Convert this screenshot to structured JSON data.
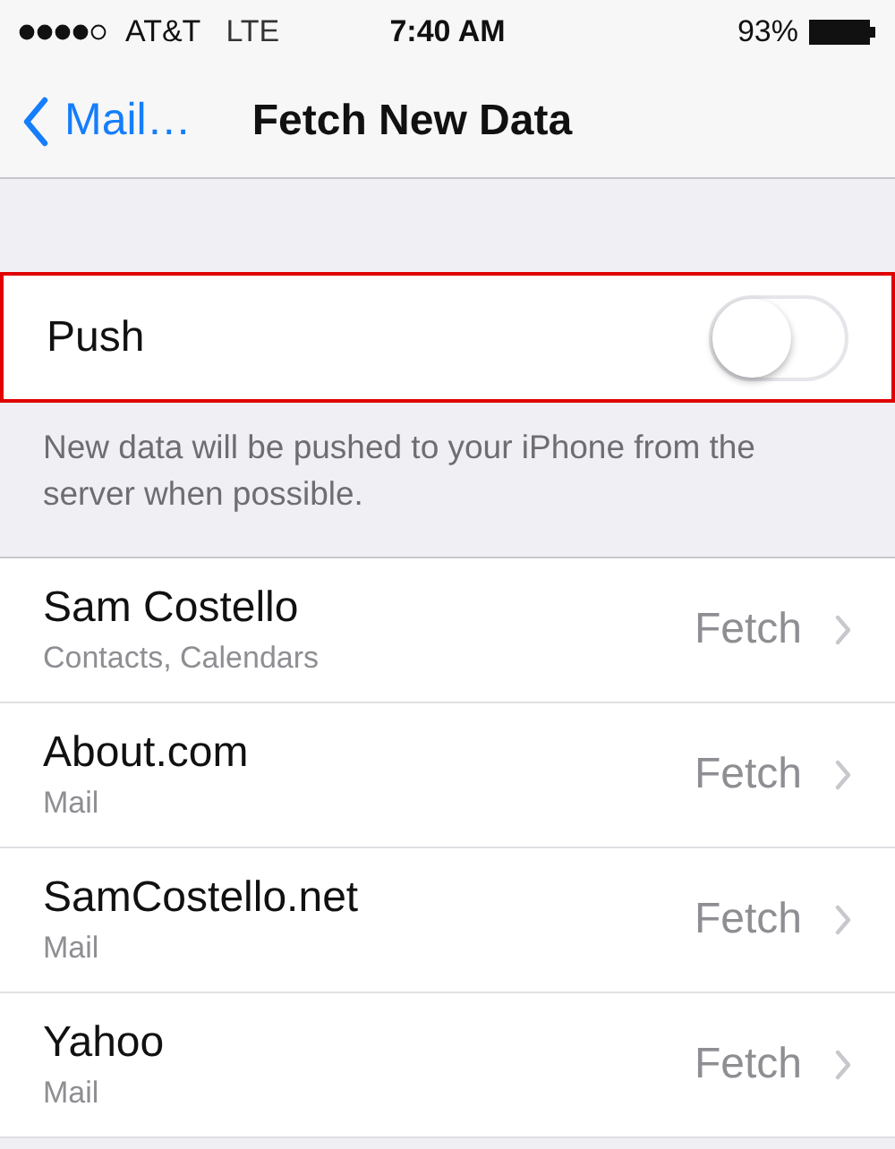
{
  "status_bar": {
    "carrier": "AT&T",
    "network": "LTE",
    "time": "7:40 AM",
    "battery": "93%"
  },
  "nav_bar": {
    "back": "Mail…",
    "title": "Fetch New Data"
  },
  "push": {
    "label": "Push",
    "on": false,
    "highlighted": true,
    "footer": "New data will be pushed to your iPhone from the server when possible."
  },
  "accounts": [
    {
      "name": "Sam Costello",
      "detail": "Contacts, Calendars",
      "value": "Fetch"
    },
    {
      "name": "About.com",
      "detail": "Mail",
      "value": "Fetch"
    },
    {
      "name": "SamCostello.net",
      "detail": "Mail",
      "value": "Fetch"
    },
    {
      "name": "Yahoo",
      "detail": "Mail",
      "value": "Fetch"
    }
  ]
}
